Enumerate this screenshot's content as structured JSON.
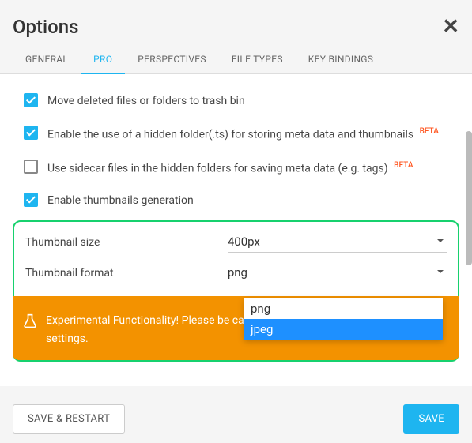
{
  "title": "Options",
  "tabs": [
    {
      "label": "GENERAL"
    },
    {
      "label": "PRO"
    },
    {
      "label": "PERSPECTIVES"
    },
    {
      "label": "FILE TYPES"
    },
    {
      "label": "KEY BINDINGS"
    }
  ],
  "options": {
    "trash": {
      "label": "Move deleted files or folders to trash bin"
    },
    "hiddenFolder": {
      "label": "Enable the use of a hidden folder(.ts) for storing meta data and thumbnails",
      "beta": "BETA"
    },
    "sidecar": {
      "label": "Use sidecar files in the hidden folders for saving meta data (e.g. tags)",
      "beta": "BETA"
    },
    "thumbs": {
      "label": "Enable thumbnails generation"
    }
  },
  "fields": {
    "size": {
      "label": "Thumbnail size",
      "value": "400px"
    },
    "format": {
      "label": "Thumbnail format",
      "value": "png"
    }
  },
  "dropdown": {
    "opt1": "png",
    "opt2": "jpeg"
  },
  "warning": "Experimental Functionality! Please be careful changing any of the following settings.",
  "buttons": {
    "saveRestart": "SAVE & RESTART",
    "save": "SAVE"
  }
}
